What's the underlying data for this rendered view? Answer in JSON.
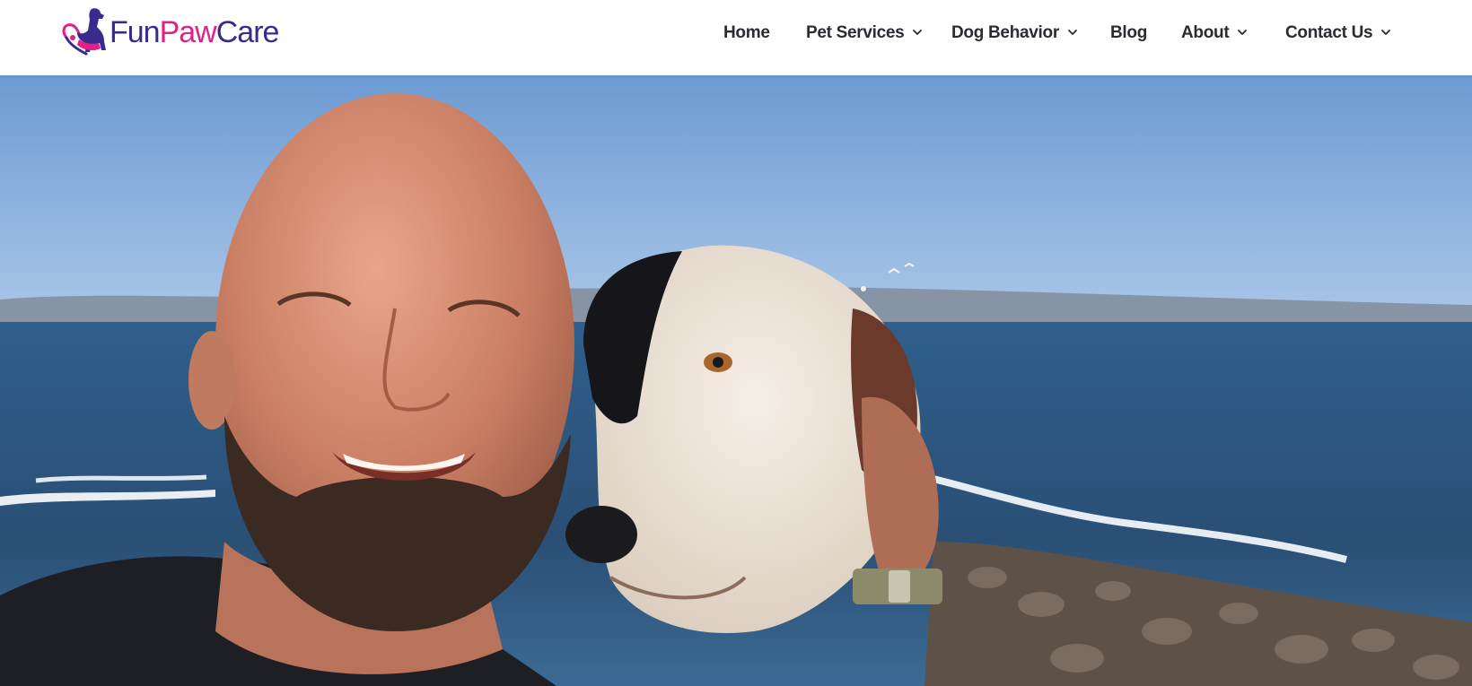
{
  "brand": {
    "logo_fun": "Fun",
    "logo_paw": "Paw",
    "logo_care": "Care",
    "colors": {
      "primary": "#3a2a8c",
      "accent": "#e0218a"
    }
  },
  "nav": {
    "home": "Home",
    "pet_services": "Pet Services",
    "dog_behavior": "Dog Behavior",
    "blog": "Blog",
    "about": "About",
    "contact_us": "Contact Us",
    "dropdown_icon": "chevron-down-icon"
  },
  "hero": {
    "image": "photo of smiling bald bearded man with black-and-white dog by the ocean"
  }
}
